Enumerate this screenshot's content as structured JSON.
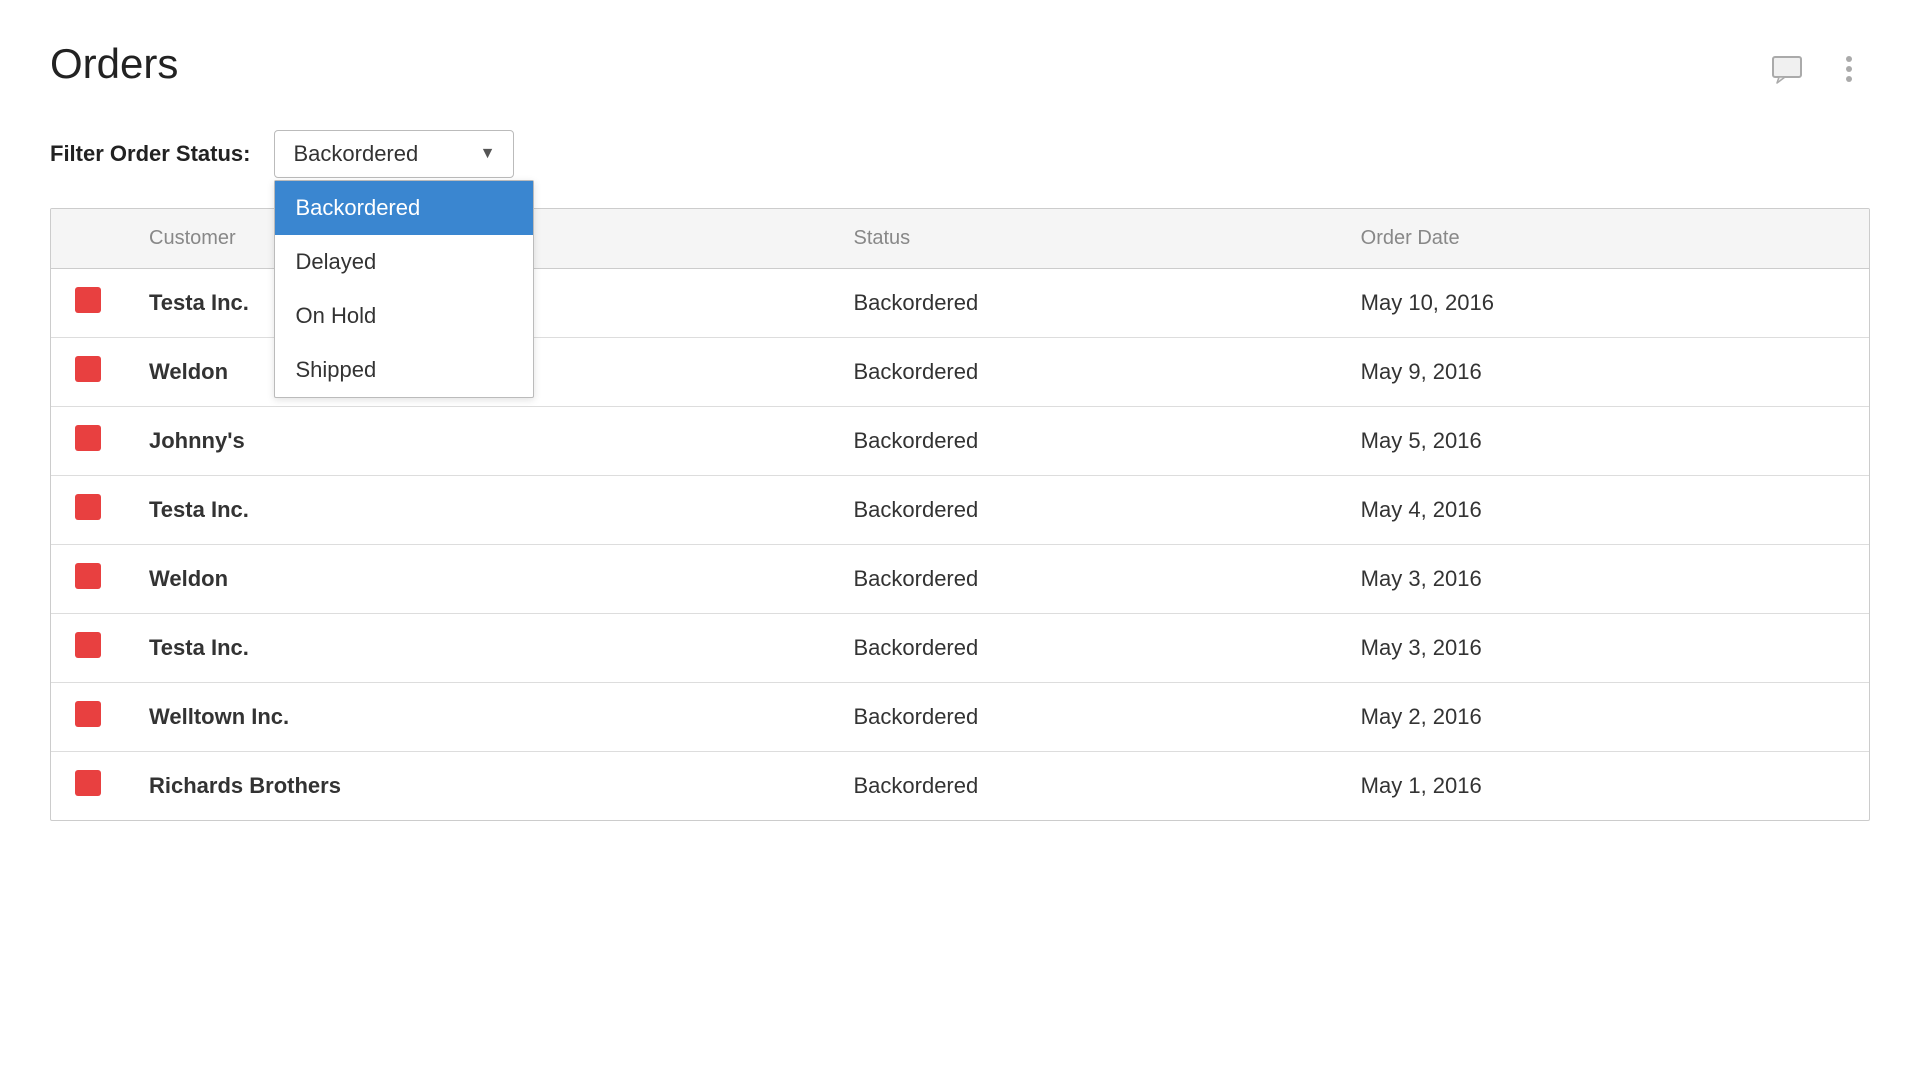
{
  "page": {
    "title": "Orders",
    "header_icons": [
      "comment-icon",
      "more-icon"
    ]
  },
  "filter": {
    "label": "Filter Order Status:",
    "selected": "Backordered",
    "options": [
      {
        "value": "Backordered",
        "label": "Backordered",
        "active": true
      },
      {
        "value": "Delayed",
        "label": "Delayed",
        "active": false
      },
      {
        "value": "On Hold",
        "label": "On Hold",
        "active": false
      },
      {
        "value": "Shipped",
        "label": "Shipped",
        "active": false
      }
    ]
  },
  "table": {
    "columns": [
      {
        "key": "icon",
        "label": ""
      },
      {
        "key": "customer",
        "label": "Customer"
      },
      {
        "key": "status",
        "label": "Status"
      },
      {
        "key": "order_date",
        "label": "Order Date"
      }
    ],
    "rows": [
      {
        "icon": "red",
        "customer": "Testa Inc.",
        "status": "Backordered",
        "order_date": "May 10, 2016"
      },
      {
        "icon": "red",
        "customer": "Weldon",
        "status": "Backordered",
        "order_date": "May 9, 2016"
      },
      {
        "icon": "red",
        "customer": "Johnny's",
        "status": "Backordered",
        "order_date": "May 5, 2016"
      },
      {
        "icon": "red",
        "customer": "Testa Inc.",
        "status": "Backordered",
        "order_date": "May 4, 2016"
      },
      {
        "icon": "red",
        "customer": "Weldon",
        "status": "Backordered",
        "order_date": "May 3, 2016"
      },
      {
        "icon": "red",
        "customer": "Testa Inc.",
        "status": "Backordered",
        "order_date": "May 3, 2016"
      },
      {
        "icon": "red",
        "customer": "Welltown Inc.",
        "status": "Backordered",
        "order_date": "May 2, 2016"
      },
      {
        "icon": "red",
        "customer": "Richards Brothers",
        "status": "Backordered",
        "order_date": "May 1, 2016"
      }
    ]
  }
}
